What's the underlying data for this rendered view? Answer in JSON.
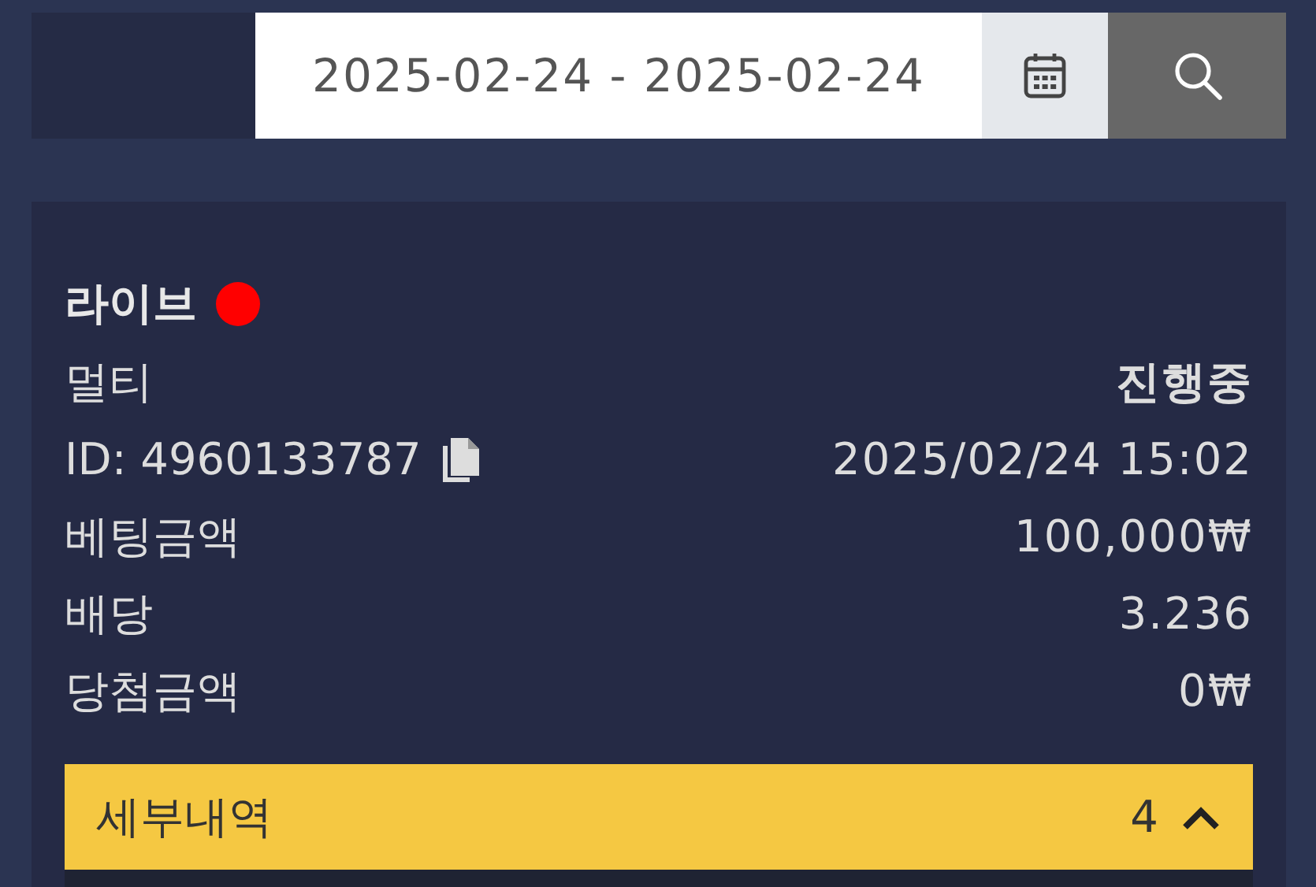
{
  "date_range": {
    "value": "2025-02-24 - 2025-02-24"
  },
  "bet": {
    "title": "라이브",
    "live": true,
    "rows": [
      {
        "label": "멀티",
        "value": "진행중",
        "kind": "status"
      },
      {
        "label": "ID: 4960133787",
        "value": "2025/02/24 15:02",
        "kind": "id"
      },
      {
        "label": "베팅금액",
        "value": "100,000₩",
        "kind": "amount"
      },
      {
        "label": "배당",
        "value": "3.236",
        "kind": "amount"
      },
      {
        "label": "당첨금액",
        "value": "0₩",
        "kind": "amount"
      }
    ],
    "details": {
      "label": "세부내역",
      "count": "4",
      "expanded": true
    }
  }
}
